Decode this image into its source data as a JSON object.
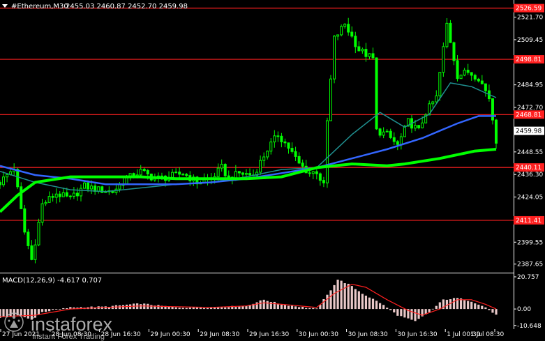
{
  "header": {
    "symbol": "#Ethereum,M30",
    "ohlc": "2455.03 2460.87 2452.70 2459.98",
    "macd_label": "MACD(12,26,9) -4.617 0.707"
  },
  "watermark": {
    "brand": "instaforex",
    "tagline": "Instant Forex Trading"
  },
  "colors": {
    "background": "#000000",
    "candle": "#00ff00",
    "ma_slow": "#00ff00",
    "ma_mid": "#3366ff",
    "ma_fast": "#1f8f8f",
    "level_line": "#ff2020",
    "price_tag_bg": "#ffffff",
    "level_tag_bg": "#ff2020",
    "macd_hist": "#e8c8c8",
    "macd_signal": "#ff2020"
  },
  "chart_data": {
    "type": "candlestick",
    "title": "#Ethereum,M30",
    "y_range": [
      2383,
      2531
    ],
    "y_ticks": [
      "2521.70",
      "2509.45",
      "2484.95",
      "2472.70",
      "2448.55",
      "2436.30",
      "2424.05",
      "2399.55",
      "2387.65"
    ],
    "current_price": "2459.98",
    "levels": [
      "2526.59",
      "2498.81",
      "2468.81",
      "2440.11",
      "2411.41"
    ],
    "x_ticks": [
      "27 Jun 2021",
      "28 Jun 08:30",
      "28 Jun 16:30",
      "29 Jun 00:30",
      "29 Jun 08:30",
      "29 Jun 16:30",
      "30 Jun 00:30",
      "30 Jun 08:30",
      "30 Jun 16:30",
      "1 Jul 00:30",
      "1 Jul 08:30"
    ],
    "price_path": [
      [
        0,
        2432
      ],
      [
        4,
        2440
      ],
      [
        7,
        2405
      ],
      [
        9,
        2390
      ],
      [
        12,
        2420
      ],
      [
        16,
        2426
      ],
      [
        20,
        2423
      ],
      [
        24,
        2430
      ],
      [
        28,
        2428
      ],
      [
        32,
        2427
      ],
      [
        36,
        2434
      ],
      [
        40,
        2438
      ],
      [
        44,
        2434
      ],
      [
        48,
        2435
      ],
      [
        52,
        2437
      ],
      [
        56,
        2432
      ],
      [
        60,
        2434
      ],
      [
        63,
        2440
      ],
      [
        65,
        2434
      ],
      [
        68,
        2437
      ],
      [
        72,
        2436
      ],
      [
        76,
        2450
      ],
      [
        79,
        2458
      ],
      [
        82,
        2451
      ],
      [
        85,
        2442
      ],
      [
        88,
        2437
      ],
      [
        90,
        2438
      ],
      [
        92,
        2430
      ],
      [
        93,
        2465
      ],
      [
        95,
        2510
      ],
      [
        98,
        2518
      ],
      [
        102,
        2504
      ],
      [
        106,
        2499
      ],
      [
        107,
        2460
      ],
      [
        110,
        2458
      ],
      [
        113,
        2452
      ],
      [
        116,
        2465
      ],
      [
        119,
        2460
      ],
      [
        121,
        2470
      ],
      [
        124,
        2478
      ],
      [
        127,
        2518
      ],
      [
        130,
        2490
      ],
      [
        133,
        2492
      ],
      [
        136,
        2489
      ],
      [
        139,
        2478
      ],
      [
        141,
        2455
      ]
    ],
    "ma_fast": [
      [
        0,
        2438
      ],
      [
        10,
        2432
      ],
      [
        20,
        2428
      ],
      [
        30,
        2427
      ],
      [
        40,
        2429
      ],
      [
        50,
        2431
      ],
      [
        60,
        2432
      ],
      [
        70,
        2435
      ],
      [
        80,
        2439
      ],
      [
        90,
        2440
      ],
      [
        100,
        2458
      ],
      [
        108,
        2470
      ],
      [
        115,
        2462
      ],
      [
        122,
        2469
      ],
      [
        128,
        2486
      ],
      [
        134,
        2484
      ],
      [
        141,
        2478
      ]
    ],
    "ma_mid": [
      [
        0,
        2441
      ],
      [
        10,
        2436
      ],
      [
        20,
        2434
      ],
      [
        30,
        2431
      ],
      [
        40,
        2431
      ],
      [
        50,
        2431
      ],
      [
        60,
        2432
      ],
      [
        70,
        2434
      ],
      [
        80,
        2437
      ],
      [
        90,
        2440
      ],
      [
        100,
        2445
      ],
      [
        110,
        2450
      ],
      [
        120,
        2456
      ],
      [
        130,
        2464
      ],
      [
        136,
        2468
      ],
      [
        141,
        2468
      ]
    ],
    "ma_slow": [
      [
        0,
        2416
      ],
      [
        5,
        2425
      ],
      [
        10,
        2432
      ],
      [
        20,
        2435
      ],
      [
        30,
        2435
      ],
      [
        40,
        2435
      ],
      [
        50,
        2434
      ],
      [
        60,
        2434
      ],
      [
        70,
        2434
      ],
      [
        80,
        2435
      ],
      [
        90,
        2440
      ],
      [
        100,
        2442
      ],
      [
        110,
        2441
      ],
      [
        115,
        2442
      ],
      [
        125,
        2445
      ],
      [
        135,
        2449
      ],
      [
        141,
        2450
      ]
    ],
    "macd": {
      "y_range": [
        -13,
        23
      ],
      "y_ticks": [
        "20.757",
        "0.00",
        "-10.648"
      ],
      "histogram": [
        [
          0,
          -6
        ],
        [
          5,
          -4
        ],
        [
          9,
          -7
        ],
        [
          12,
          -2
        ],
        [
          20,
          1
        ],
        [
          30,
          1.5
        ],
        [
          40,
          3.5
        ],
        [
          50,
          1
        ],
        [
          60,
          1
        ],
        [
          70,
          2
        ],
        [
          75,
          6
        ],
        [
          80,
          3
        ],
        [
          90,
          0
        ],
        [
          93,
          9
        ],
        [
          96,
          19
        ],
        [
          99,
          16
        ],
        [
          103,
          10
        ],
        [
          108,
          4
        ],
        [
          113,
          -4
        ],
        [
          118,
          -8
        ],
        [
          122,
          -2
        ],
        [
          126,
          6
        ],
        [
          130,
          7
        ],
        [
          134,
          5
        ],
        [
          138,
          1
        ],
        [
          141,
          -4
        ]
      ],
      "signal": [
        [
          0,
          -5
        ],
        [
          10,
          -4
        ],
        [
          20,
          0
        ],
        [
          30,
          1
        ],
        [
          40,
          2
        ],
        [
          50,
          1.5
        ],
        [
          60,
          1
        ],
        [
          70,
          2
        ],
        [
          75,
          4
        ],
        [
          80,
          3
        ],
        [
          90,
          1
        ],
        [
          95,
          10
        ],
        [
          100,
          16
        ],
        [
          104,
          14
        ],
        [
          110,
          6
        ],
        [
          116,
          -1
        ],
        [
          120,
          -4
        ],
        [
          125,
          0
        ],
        [
          130,
          6
        ],
        [
          134,
          6
        ],
        [
          138,
          3
        ],
        [
          141,
          0
        ]
      ]
    }
  }
}
